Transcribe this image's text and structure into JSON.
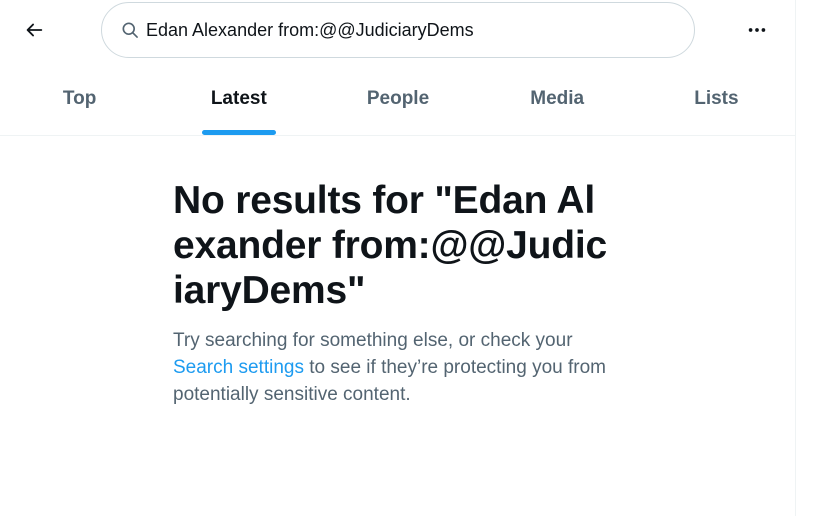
{
  "header": {
    "back_label": "Back",
    "search": {
      "value": "Edan Alexander from:@@JudiciaryDems",
      "placeholder": "Search"
    },
    "more_label": "More"
  },
  "tabs": [
    {
      "label": "Top"
    },
    {
      "label": "Latest",
      "active": true
    },
    {
      "label": "People"
    },
    {
      "label": "Media"
    },
    {
      "label": "Lists"
    }
  ],
  "empty_state": {
    "title": "No results for \"Edan Alexander from:@@JudiciaryDems\"",
    "body_before_link": "Try searching for something else, or check your ",
    "link": "Search settings",
    "body_after_link": " to see if they’re protecting you from potentially sensitive content."
  },
  "colors": {
    "accent": "#1d9bf0",
    "text_primary": "#0f1419",
    "text_secondary": "#536471",
    "border": "#cfd9de"
  },
  "icons": {
    "back": "arrow-left-icon",
    "search": "search-icon",
    "more": "more-horizontal-icon"
  }
}
